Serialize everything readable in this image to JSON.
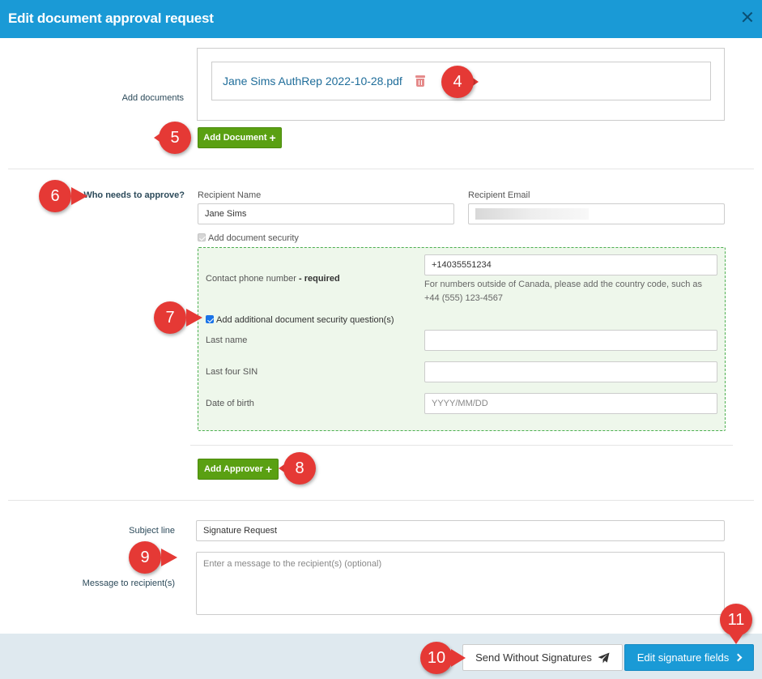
{
  "dialog": {
    "title": "Edit document approval request"
  },
  "documents": {
    "label": "Add documents",
    "file_name": "Jane Sims AuthRep 2022-10-28.pdf",
    "add_button": "Add Document"
  },
  "approvers": {
    "label": "Who needs to approve?",
    "recipient_name_label": "Recipient Name",
    "recipient_name_value": "Jane Sims",
    "recipient_email_label": "Recipient Email",
    "recipient_email_value": "",
    "add_security_label": "Add document security",
    "add_security_checked": true,
    "security": {
      "phone_label": "Contact phone number",
      "phone_required": "- required",
      "phone_value": "+14035551234",
      "phone_help": "For numbers outside of Canada, please add the country code, such as +44 (555) 123-4567",
      "questions_label": "Add additional document security question(s)",
      "questions_checked": true,
      "last_name_label": "Last name",
      "last_name_value": "",
      "sin_label": "Last four SIN",
      "sin_value": "",
      "dob_label": "Date of birth",
      "dob_placeholder": "YYYY/MM/DD"
    },
    "add_approver_button": "Add Approver"
  },
  "message": {
    "subject_label": "Subject line",
    "subject_value": "Signature Request",
    "message_label": "Message to recipient(s)",
    "message_placeholder": "Enter a message to the recipient(s) (optional)"
  },
  "footer": {
    "send_button": "Send Without Signatures",
    "edit_button": "Edit signature fields"
  },
  "callouts": [
    "4",
    "5",
    "6",
    "7",
    "8",
    "9",
    "10",
    "11"
  ],
  "colors": {
    "header": "#1a9ad6",
    "green_button": "#5aa012",
    "callout": "#e53935",
    "security_bg": "#eef7eb"
  },
  "icons": {
    "close": "close-icon",
    "trash": "trash-icon",
    "plus": "plus-icon",
    "send": "paper-plane-icon",
    "chevron": "chevron-right-icon"
  }
}
